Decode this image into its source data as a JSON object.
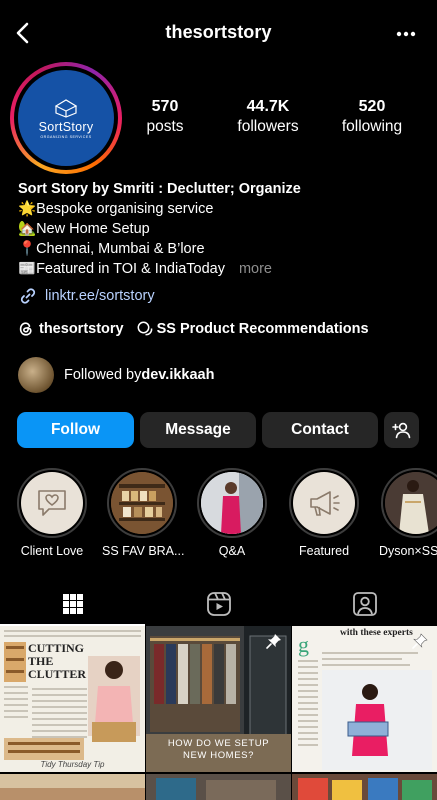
{
  "header": {
    "username": "thesortstory"
  },
  "avatar": {
    "logo_text": "SortStory",
    "logo_subtext": "ORGANIZING SERVICES"
  },
  "stats": [
    {
      "value": "570",
      "label": "posts"
    },
    {
      "value": "44.7K",
      "label": "followers"
    },
    {
      "value": "520",
      "label": "following"
    }
  ],
  "bio": {
    "name": "Sort Story by Smriti : Declutter; Organize",
    "lines": [
      {
        "emoji": "🌟",
        "text": "Bespoke organising service"
      },
      {
        "emoji": "🏡",
        "text": "New Home Setup"
      },
      {
        "emoji": "📍",
        "text": "Chennai, Mumbai & B’lore"
      },
      {
        "emoji": "📰",
        "text": "Featured in TOI & IndiaToday"
      }
    ],
    "more_label": "more",
    "link": "linktr.ee/sortstory"
  },
  "tags": {
    "threads": "thesortstory",
    "broadcast": "SS Product Recommendations"
  },
  "followed_by": {
    "prefix": "Followed by ",
    "name": "dev.ikkaah"
  },
  "buttons": {
    "follow": "Follow",
    "message": "Message",
    "contact": "Contact"
  },
  "highlights": [
    {
      "label": "Client Love",
      "icon": "chat-heart-icon"
    },
    {
      "label": "SS FAV BRA...",
      "icon": "shelf-photo"
    },
    {
      "label": "Q&A",
      "icon": "person-photo"
    },
    {
      "label": "Featured",
      "icon": "megaphone-icon"
    },
    {
      "label": "Dyson×SS",
      "icon": "person-photo"
    }
  ],
  "posts": [
    {
      "title": "CUTTING THE CLUTTER",
      "footer": "Tidy Thursday Tip"
    },
    {
      "caption": "HOW DO WE SETUP NEW HOMES?"
    },
    {
      "heading": "with these experts"
    }
  ],
  "colors": {
    "follow": "#0a95f6",
    "secondary_button": "#262626",
    "link": "#b9d2ff",
    "muted": "#8e8e8e",
    "logo_bg": "#1552a6"
  }
}
